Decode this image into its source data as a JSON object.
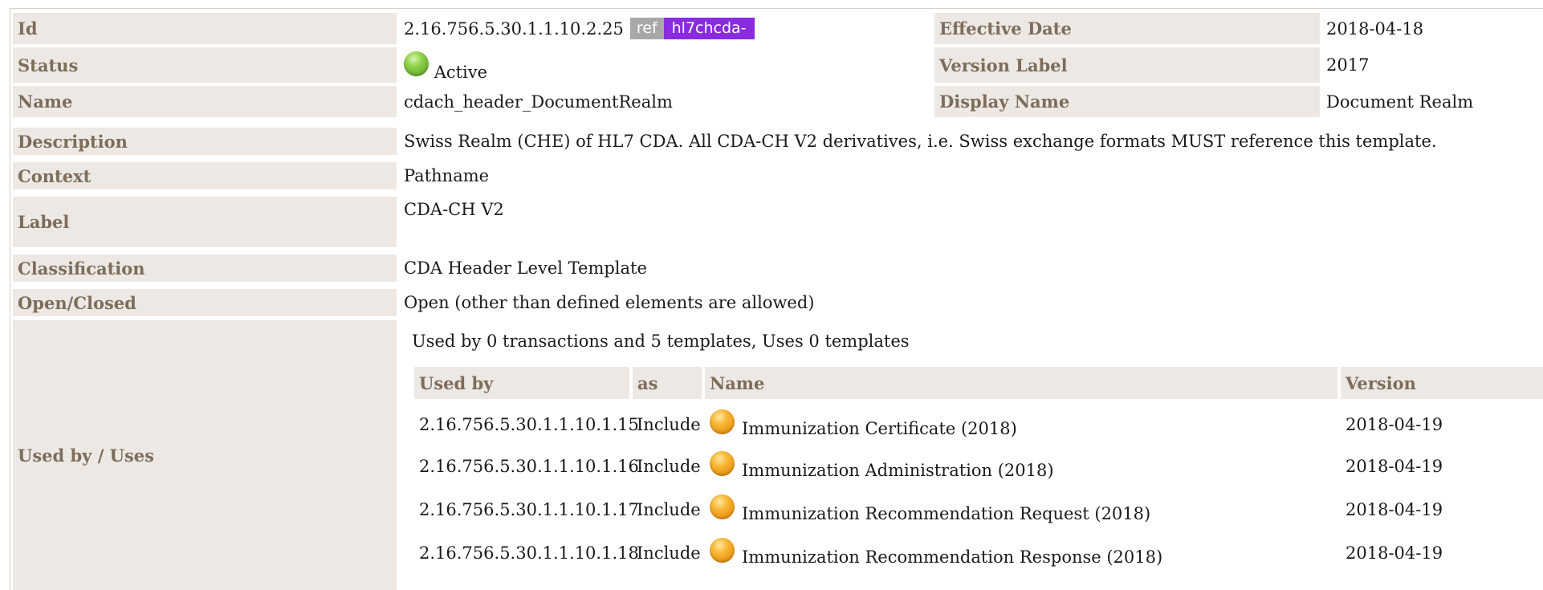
{
  "rows": {
    "id": {
      "label": "Id",
      "value": "2.16.756.5.30.1.1.10.2.25",
      "ref_tag": "ref",
      "prefix_tag": "hl7chcda-"
    },
    "effective_date": {
      "label": "Effective Date",
      "value": "2018-04-18"
    },
    "status": {
      "label": "Status",
      "value": "Active",
      "icon": "status-active-icon",
      "color": "#6cbf2e"
    },
    "version_label": {
      "label": "Version Label",
      "value": "2017"
    },
    "name": {
      "label": "Name",
      "value": "cdach_header_DocumentRealm"
    },
    "display_name": {
      "label": "Display Name",
      "value": "Document Realm"
    },
    "description": {
      "label": "Description",
      "value": "Swiss Realm (CHE) of HL7 CDA. All CDA-CH V2 derivatives, i.e. Swiss exchange formats MUST reference this template."
    },
    "context": {
      "label": "Context",
      "value": "Pathname"
    },
    "label": {
      "label": "Label",
      "value": "CDA-CH V2"
    },
    "classification": {
      "label": "Classification",
      "value": "CDA Header Level Template"
    },
    "open_closed": {
      "label": "Open/Closed",
      "value": "Open (other than defined elements are allowed)"
    },
    "used_by": {
      "label": "Used by / Uses"
    }
  },
  "usage": {
    "summary": "Used by 0 transactions and 5 templates, Uses 0 templates",
    "columns": [
      "Used by",
      "as",
      "Name",
      "Version"
    ],
    "items": [
      {
        "id": "2.16.756.5.30.1.1.10.1.15",
        "as": "Include",
        "name": "Immunization Certificate (2018)",
        "version": "2018-04-19",
        "status_icon": "status-draft-icon"
      },
      {
        "id": "2.16.756.5.30.1.1.10.1.16",
        "as": "Include",
        "name": "Immunization Administration (2018)",
        "version": "2018-04-19",
        "status_icon": "status-draft-icon"
      },
      {
        "id": "2.16.756.5.30.1.1.10.1.17",
        "as": "Include",
        "name": "Immunization Recommendation Request (2018)",
        "version": "2018-04-19",
        "status_icon": "status-draft-icon"
      },
      {
        "id": "2.16.756.5.30.1.1.10.1.18",
        "as": "Include",
        "name": "Immunization Recommendation Response (2018)",
        "version": "2018-04-19",
        "status_icon": "status-draft-icon"
      }
    ]
  },
  "colors": {
    "label_bg": "#ede8e3",
    "label_text": "#7d6d5b",
    "ref_tag_bg": "#a8a8a8",
    "prefix_tag_bg": "#8a2be2",
    "status_draft": "#f0a020"
  }
}
